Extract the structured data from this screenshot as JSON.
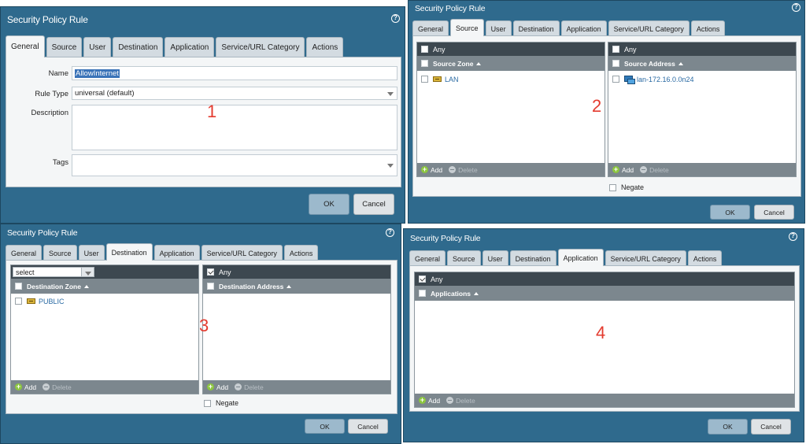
{
  "dialog_title": "Security Policy Rule",
  "help_glyph": "?",
  "tabs": [
    "General",
    "Source",
    "User",
    "Destination",
    "Application",
    "Service/URL Category",
    "Actions"
  ],
  "buttons": {
    "ok": "OK",
    "cancel": "Cancel"
  },
  "grid_actions": {
    "add": "Add",
    "delete": "Delete"
  },
  "any_label": "Any",
  "negate_label": "Negate",
  "panel1": {
    "number": "1",
    "active_tab": "General",
    "name_label": "Name",
    "name_value": "AllowInternet",
    "rule_type_label": "Rule Type",
    "rule_type_value": "universal (default)",
    "description_label": "Description",
    "tags_label": "Tags"
  },
  "panel2": {
    "number": "2",
    "active_tab": "Source",
    "zone_header": "Source Zone",
    "zone_items": [
      "LAN"
    ],
    "address_header": "Source Address",
    "address_items": [
      "lan-172.16.0.0n24"
    ]
  },
  "panel3": {
    "number": "3",
    "active_tab": "Destination",
    "select_value": "select",
    "zone_header": "Destination Zone",
    "zone_items": [
      "PUBLIC"
    ],
    "address_header": "Destination Address"
  },
  "panel4": {
    "number": "4",
    "active_tab": "Application",
    "apps_header": "Applications"
  },
  "icons": {
    "help": "help-icon",
    "add": "add-icon",
    "delete": "delete-icon",
    "zone": "zone-icon",
    "address": "address-object-icon"
  },
  "colors": {
    "dialog_bg": "#2f6a8d",
    "number_red": "#e43b2f",
    "ok_button": "#9cb9cc"
  }
}
